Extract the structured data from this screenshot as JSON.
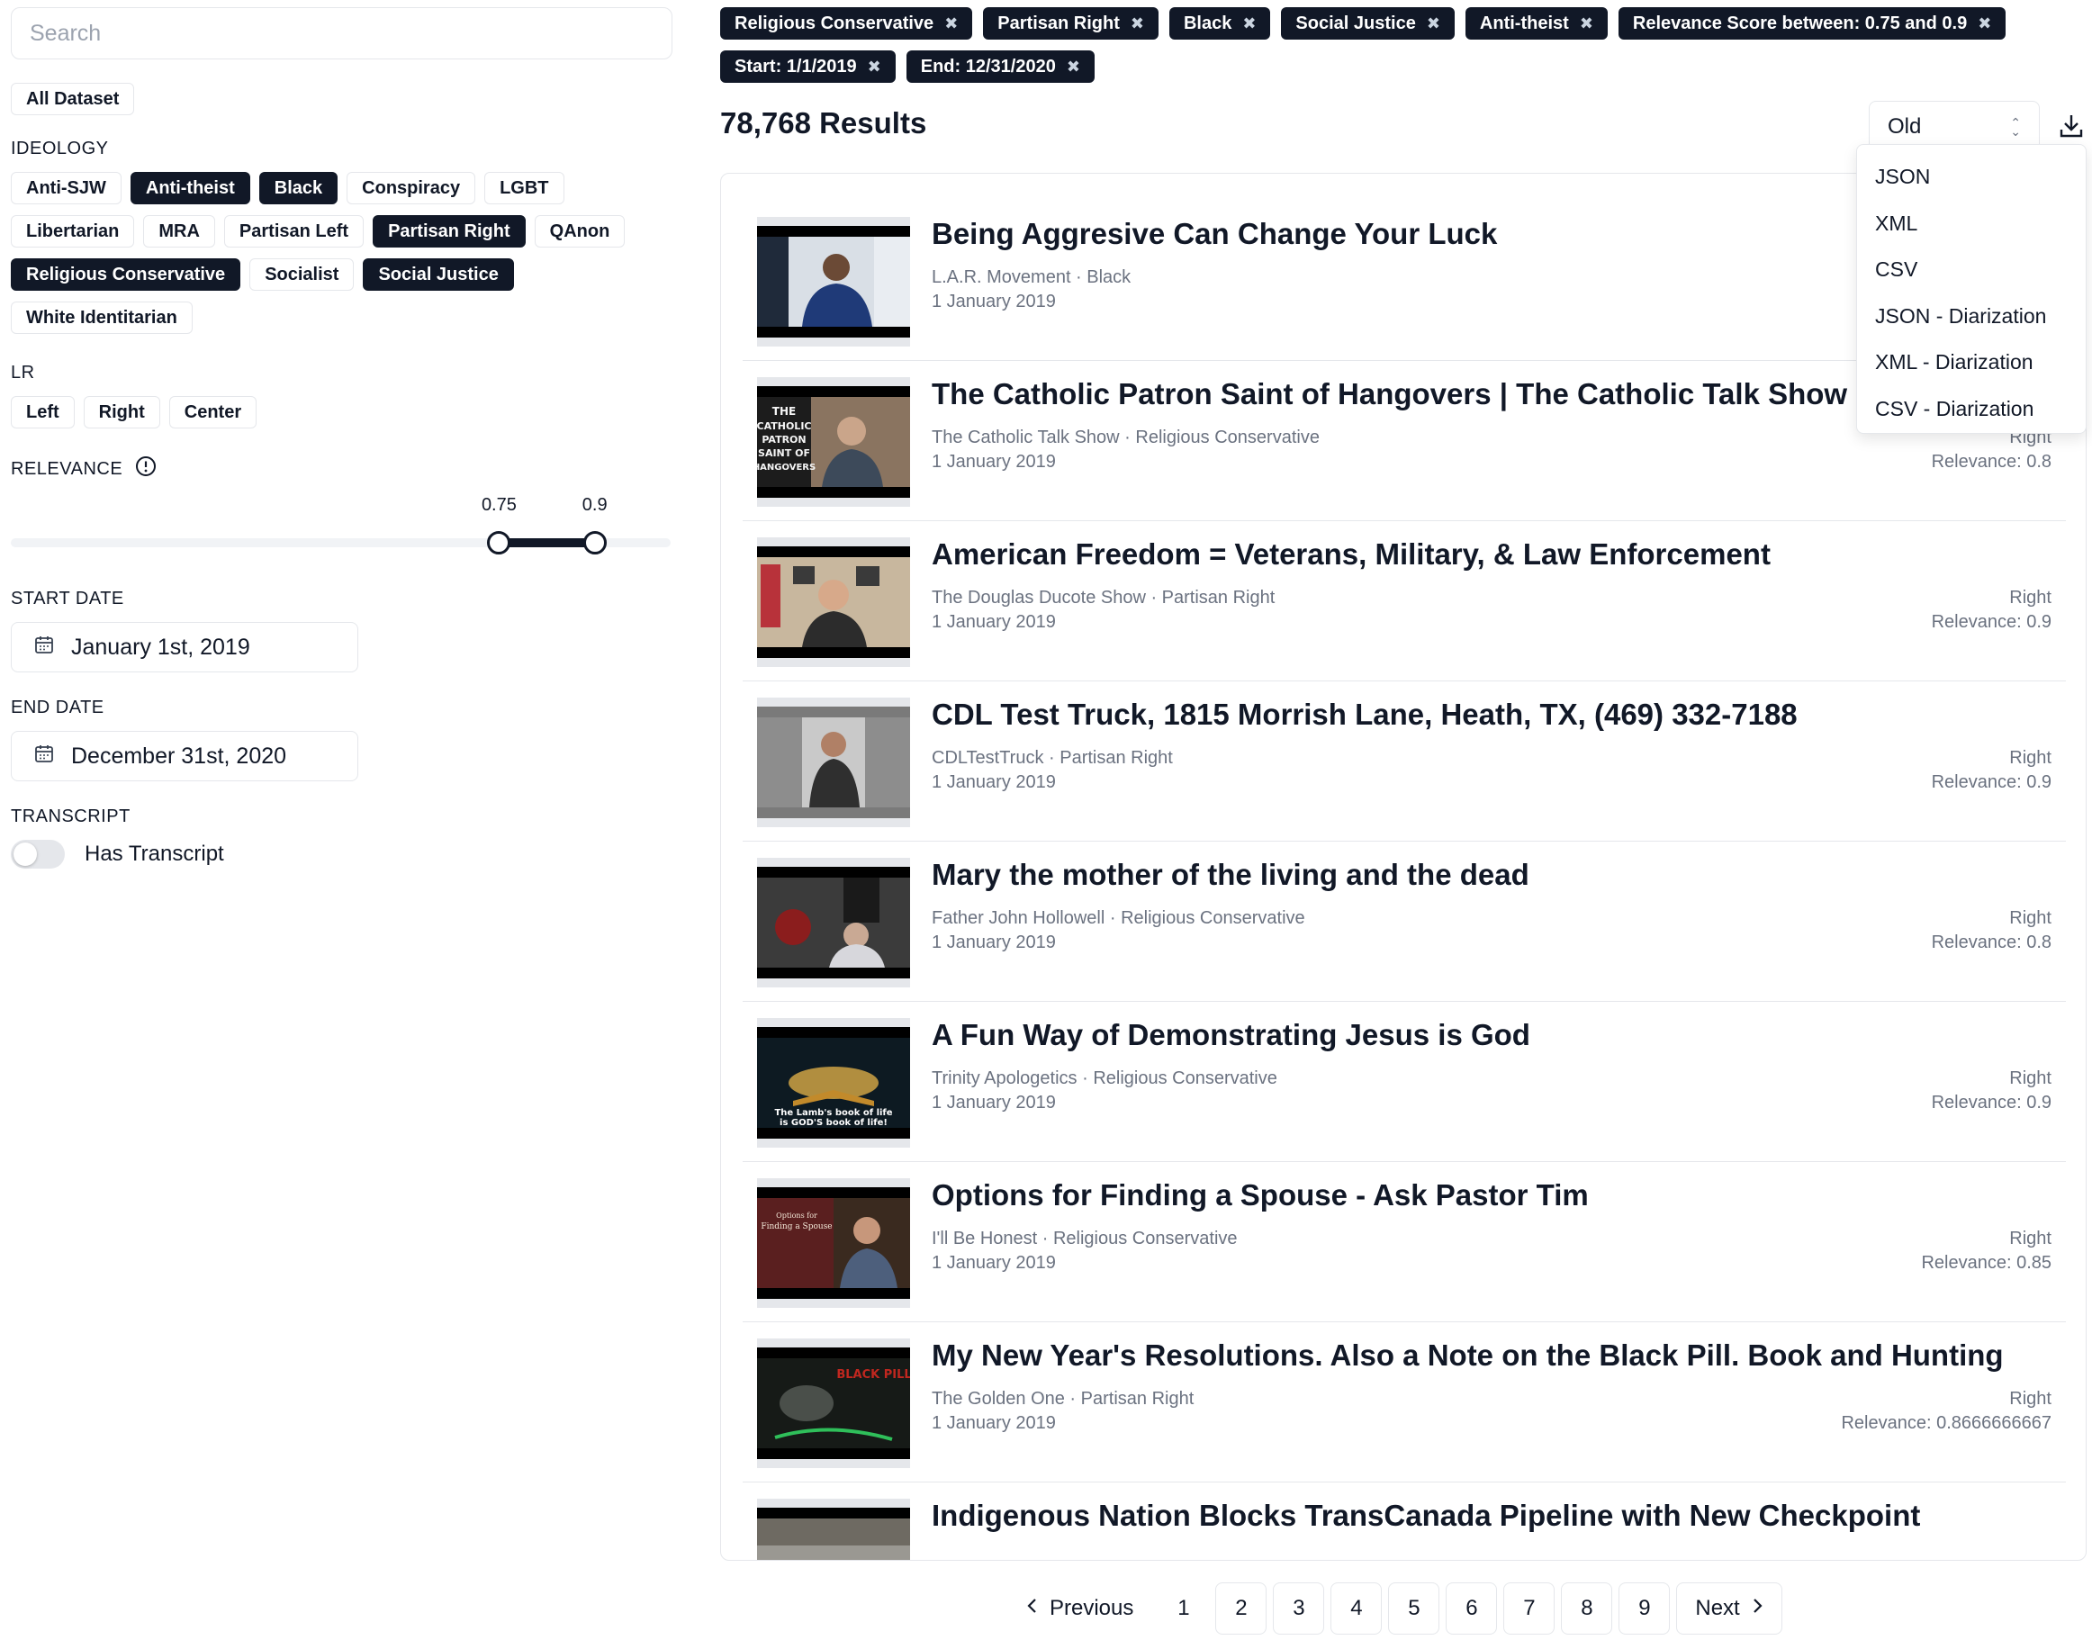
{
  "search": {
    "placeholder": "Search"
  },
  "dataset_chip": "All Dataset",
  "ideology": {
    "label": "IDEOLOGY",
    "chips": [
      {
        "label": "Anti-SJW",
        "selected": false
      },
      {
        "label": "Anti-theist",
        "selected": true
      },
      {
        "label": "Black",
        "selected": true
      },
      {
        "label": "Conspiracy",
        "selected": false
      },
      {
        "label": "LGBT",
        "selected": false
      },
      {
        "label": "Libertarian",
        "selected": false
      },
      {
        "label": "MRA",
        "selected": false
      },
      {
        "label": "Partisan Left",
        "selected": false
      },
      {
        "label": "Partisan Right",
        "selected": true
      },
      {
        "label": "QAnon",
        "selected": false
      },
      {
        "label": "Religious Conservative",
        "selected": true
      },
      {
        "label": "Socialist",
        "selected": false
      },
      {
        "label": "Social Justice",
        "selected": true
      },
      {
        "label": "White Identitarian",
        "selected": false
      }
    ]
  },
  "lr": {
    "label": "LR",
    "chips": [
      {
        "label": "Left"
      },
      {
        "label": "Right"
      },
      {
        "label": "Center"
      }
    ]
  },
  "relevance": {
    "label": "RELEVANCE",
    "min_label": "0.75",
    "max_label": "0.9",
    "min": 0.75,
    "max": 0.9,
    "lower_fraction": 0.74,
    "upper_fraction": 0.885,
    "info_icon": "info-icon"
  },
  "start_date": {
    "label": "START DATE",
    "value": "January 1st, 2019",
    "icon": "calendar-icon"
  },
  "end_date": {
    "label": "END DATE",
    "value": "December 31st, 2020",
    "icon": "calendar-icon"
  },
  "transcript": {
    "label": "TRANSCRIPT",
    "toggle_label": "Has Transcript",
    "enabled": false
  },
  "active_filters": [
    "Religious Conservative",
    "Partisan Right",
    "Black",
    "Social Justice",
    "Anti-theist",
    "Relevance Score between: 0.75 and 0.9",
    "Start: 1/1/2019",
    "End: 12/31/2020"
  ],
  "results_count": "78,768 Results",
  "sort": {
    "value": "Old"
  },
  "download_menu": {
    "icon": "download-icon",
    "items": [
      "JSON",
      "XML",
      "CSV",
      "JSON - Diarization",
      "XML - Diarization",
      "CSV - Diarization"
    ]
  },
  "results": [
    {
      "title": "Being Aggresive Can Change Your Luck",
      "channel_category": "L.A.R. Movement · Black",
      "date": "1 January 2019",
      "lr": "",
      "relevance": ""
    },
    {
      "title": "The Catholic Patron Saint of Hangovers | The Catholic Talk Show",
      "channel_category": "The Catholic Talk Show · Religious Conservative",
      "date": "1 January 2019",
      "lr": "Right",
      "relevance": "Relevance: 0.8"
    },
    {
      "title": "American Freedom = Veterans, Military, & Law Enforcement",
      "channel_category": "The Douglas Ducote Show · Partisan Right",
      "date": "1 January 2019",
      "lr": "Right",
      "relevance": "Relevance: 0.9"
    },
    {
      "title": "CDL Test Truck, 1815 Morrish Lane, Heath, TX, (469) 332-7188",
      "channel_category": "CDLTestTruck · Partisan Right",
      "date": "1 January 2019",
      "lr": "Right",
      "relevance": "Relevance: 0.9"
    },
    {
      "title": "Mary the mother of the living and the dead",
      "channel_category": "Father John Hollowell · Religious Conservative",
      "date": "1 January 2019",
      "lr": "Right",
      "relevance": "Relevance: 0.8"
    },
    {
      "title": "A Fun Way of Demonstrating Jesus is God",
      "channel_category": "Trinity Apologetics · Religious Conservative",
      "date": "1 January 2019",
      "lr": "Right",
      "relevance": "Relevance: 0.9"
    },
    {
      "title": "Options for Finding a Spouse - Ask Pastor Tim",
      "channel_category": "I'll Be Honest · Religious Conservative",
      "date": "1 January 2019",
      "lr": "Right",
      "relevance": "Relevance: 0.85"
    },
    {
      "title": "My New Year's Resolutions. Also a Note on the Black Pill. Book and Hunting",
      "channel_category": "The Golden One · Partisan Right",
      "date": "1 January 2019",
      "lr": "Right",
      "relevance": "Relevance: 0.8666666667"
    },
    {
      "title": "Indigenous Nation Blocks TransCanada Pipeline with New Checkpoint",
      "channel_category": "",
      "date": "",
      "lr": "",
      "relevance": ""
    }
  ],
  "thumb_texts": {
    "catholic": "THE CATHOLIC PATRON SAINT OF HANGOVERS",
    "lamb": "The Lamb's book of life is GOD'S book of life!",
    "spouse": "Options for Finding a Spouse",
    "blackpill": "BLACK PILL"
  },
  "pagination": {
    "previous": "Previous",
    "next": "Next",
    "pages": [
      "1",
      "2",
      "3",
      "4",
      "5",
      "6",
      "7",
      "8",
      "9"
    ],
    "current": "1"
  }
}
